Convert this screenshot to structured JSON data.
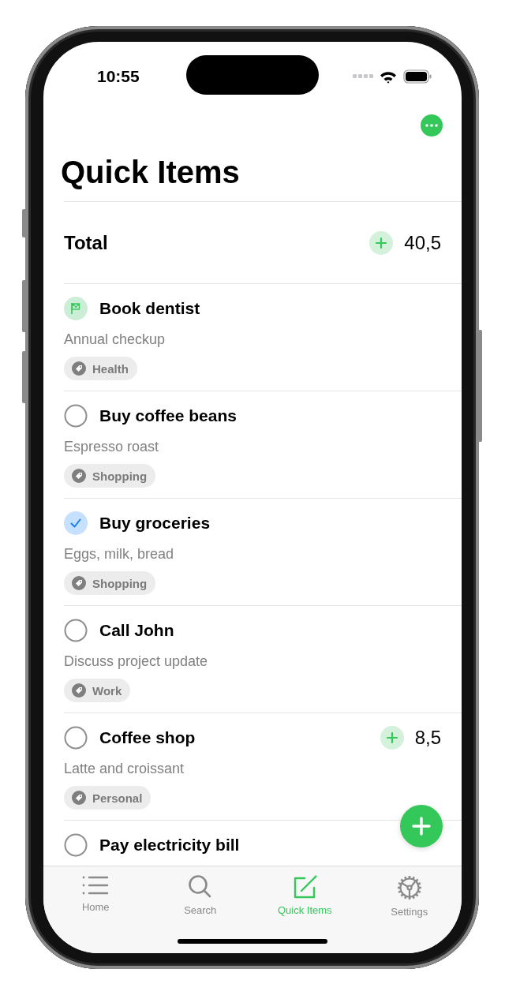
{
  "status_bar": {
    "time": "10:55"
  },
  "title": "Quick Items",
  "total": {
    "label": "Total",
    "value": "40,5"
  },
  "items": [
    {
      "kind": "flag",
      "title": "Book dentist",
      "subtitle": "Annual checkup",
      "tag": "Health"
    },
    {
      "kind": "task",
      "checked": false,
      "title": "Buy coffee beans",
      "subtitle": "Espresso roast",
      "tag": "Shopping"
    },
    {
      "kind": "task",
      "checked": true,
      "title": "Buy groceries",
      "subtitle": "Eggs, milk, bread",
      "tag": "Shopping"
    },
    {
      "kind": "task",
      "checked": false,
      "title": "Call John",
      "subtitle": "Discuss project update",
      "tag": "Work"
    },
    {
      "kind": "task",
      "checked": false,
      "title": "Coffee shop",
      "subtitle": "Latte and croissant",
      "tag": "Personal",
      "amount": "8,5"
    },
    {
      "kind": "task",
      "checked": false,
      "title": "Pay electricity bill"
    }
  ],
  "tabs": [
    {
      "label": "Home",
      "selected": false
    },
    {
      "label": "Search",
      "selected": false
    },
    {
      "label": "Quick Items",
      "selected": true
    },
    {
      "label": "Settings",
      "selected": false
    }
  ]
}
